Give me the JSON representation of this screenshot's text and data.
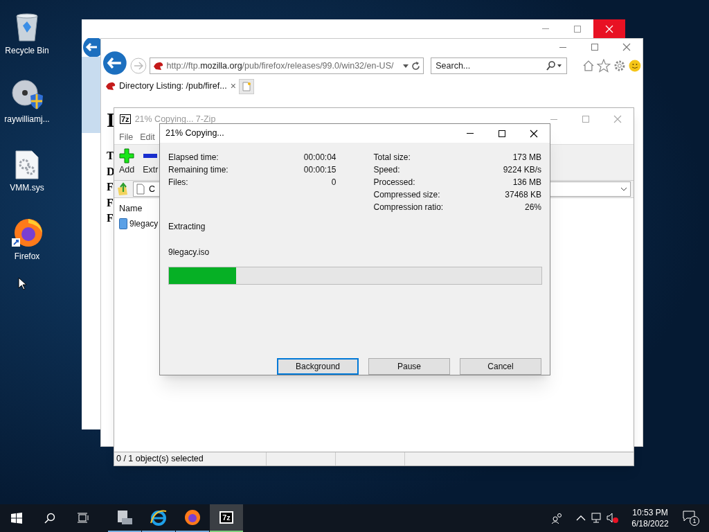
{
  "desktop_icons": [
    {
      "label": "Recycle Bin",
      "kind": "recycle"
    },
    {
      "label": "raywilliamj...",
      "kind": "disc"
    },
    {
      "label": "VMM.sys",
      "kind": "sysfile"
    },
    {
      "label": "Firefox",
      "kind": "firefox"
    }
  ],
  "browser": {
    "url_start": "http://ftp.",
    "url_domain": "mozilla.org",
    "url_end": "/pub/firefox/releases/99.0/win32/en-US/",
    "search_placeholder": "Search...",
    "tab_title": "Directory Listing: /pub/firef...",
    "tab_close": "×",
    "page_fragments": [
      "I",
      "T",
      "D",
      "F",
      "F",
      "F"
    ]
  },
  "archiver": {
    "logo": "7z",
    "title": "21% Copying... 7-Zip",
    "menu": [
      "File",
      "Edit"
    ],
    "toolbar": [
      {
        "label": "Add",
        "kind": "add"
      },
      {
        "label": "Extr",
        "kind": "extract"
      }
    ],
    "path_fragment": "C",
    "columns": [
      "Name"
    ],
    "rows": [
      "9legacy"
    ],
    "status": "0 / 1 object(s) selected"
  },
  "dialog": {
    "title": "21% Copying...",
    "left_stats": [
      {
        "label": "Elapsed time:",
        "value": "00:00:04"
      },
      {
        "label": "Remaining time:",
        "value": "00:00:15"
      },
      {
        "label": "Files:",
        "value": "0"
      }
    ],
    "right_stats": [
      {
        "label": "Total size:",
        "value": "173 MB"
      },
      {
        "label": "Speed:",
        "value": "9224 KB/s"
      },
      {
        "label": "Processed:",
        "value": "136 MB"
      },
      {
        "label": "Compressed size:",
        "value": "37468 KB"
      },
      {
        "label": "Compression ratio:",
        "value": "26%"
      }
    ],
    "operation": "Extracting",
    "file": "9legacy.iso",
    "progress": {
      "level": 0.18
    },
    "buttons": [
      {
        "label": "Background",
        "focused": true
      },
      {
        "label": "Pause",
        "focused": false
      },
      {
        "label": "Cancel",
        "focused": false
      }
    ]
  },
  "taskbar": {
    "apps": [
      {
        "kind": "server",
        "active": false
      },
      {
        "kind": "ie",
        "active": false
      },
      {
        "kind": "firefox",
        "active": false
      },
      {
        "kind": "sevenzip",
        "label": "7z",
        "active": true
      }
    ],
    "time": "10:53 PM",
    "date": "6/18/2022",
    "notifications": "1"
  }
}
